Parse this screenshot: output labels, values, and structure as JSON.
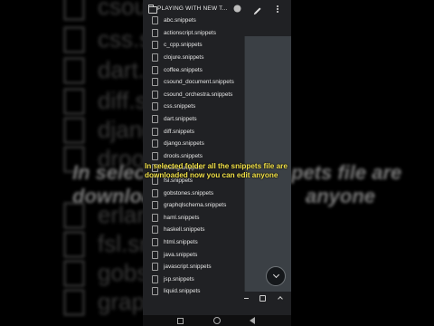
{
  "folder": {
    "title": "PLAYING WITH NEW T..."
  },
  "files": [
    "abc.snippets",
    "actionscript.snippets",
    "c_cpp.snippets",
    "clojure.snippets",
    "coffee.snippets",
    "csound_document.snippets",
    "csound_orchestra.snippets",
    "css.snippets",
    "dart.snippets",
    "diff.snippets",
    "django.snippets",
    "drools.snippets",
    "erlang.snippets",
    "fsl.snippets",
    "gobstones.snippets",
    "graphqlschema.snippets",
    "haml.snippets",
    "haskell.snippets",
    "html.snippets",
    "java.snippets",
    "javascript.snippets",
    "jsp.snippets",
    "liquid.snippets"
  ],
  "caption": "In selected folder all the snippets file are downloaded now you can edit anyone",
  "background": {
    "items": [
      "csoun",
      "css.sn",
      "dart.s",
      "diff.sn",
      "djang",
      "drools",
      "erlang",
      "fsl.sn",
      "gobst",
      "graph"
    ],
    "caption_right": [
      "pets file are",
      "anyone"
    ],
    "caption_left": [
      "In select",
      "downloa"
    ]
  },
  "icons": {
    "folder": "folder-icon",
    "settings": "gear-icon",
    "edit": "pencil-icon",
    "more": "more-vert-icon",
    "file": "file-icon",
    "fab": "chevron-down-icon",
    "save": "save-icon"
  },
  "colors": {
    "caption": "#f4e34a",
    "panel": "#3b4045",
    "app_bg": "#202124"
  }
}
